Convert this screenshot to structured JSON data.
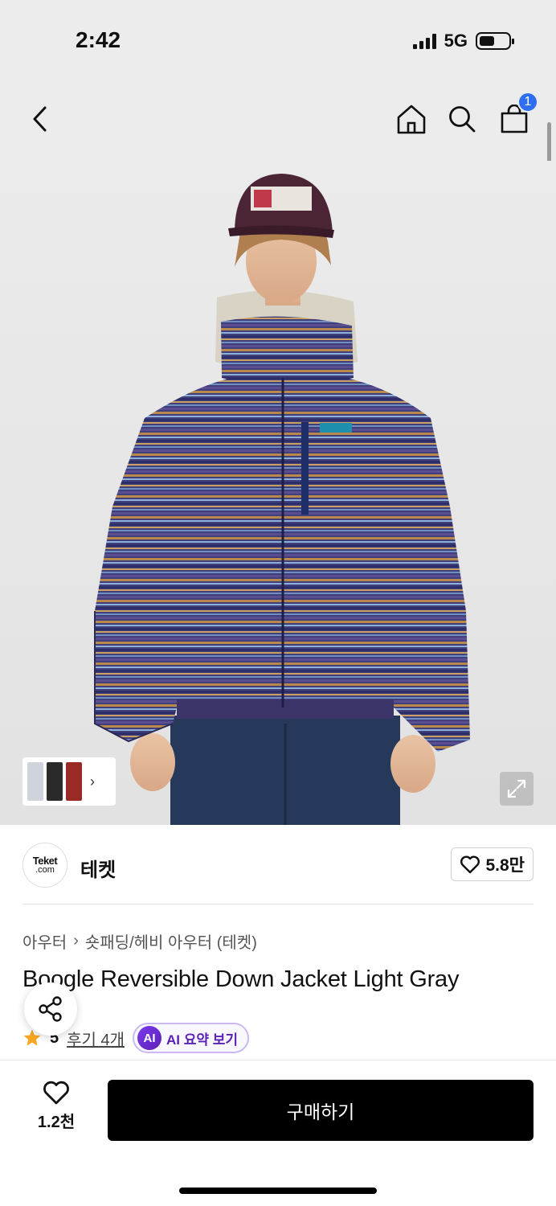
{
  "status_bar": {
    "time": "2:42",
    "network": "5G"
  },
  "nav": {
    "cart_count": "1"
  },
  "brand": {
    "logo_top": "Teket",
    "logo_bottom": ".com",
    "name": "테켓",
    "likes": "5.8만"
  },
  "breadcrumb": [
    "아우터",
    "숏패딩/헤비 아우터 (테켓)"
  ],
  "product": {
    "title": "Boogle Reversible Down Jacket Light Gray",
    "rating": "5",
    "review_link": "후기 4개",
    "ai_badge": "AI",
    "ai_summary_label": "AI 요약 보기"
  },
  "bottom_bar": {
    "wish_count": "1.2천",
    "buy_label": "구매하기"
  },
  "colors": {
    "accent": "#2f6ef0",
    "star": "#f5a623",
    "ai_purple": "#7c3aed",
    "buy_button": "#000000"
  }
}
